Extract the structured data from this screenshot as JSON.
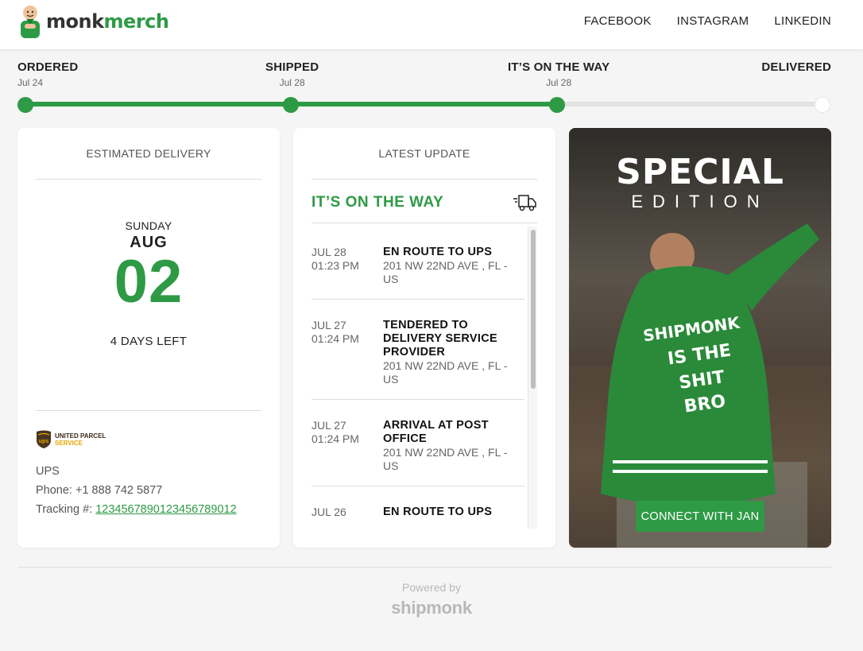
{
  "brand": {
    "part1": "monk",
    "part2": "merch",
    "accent": "#2e9a45"
  },
  "nav": [
    "FACEBOOK",
    "INSTAGRAM",
    "LINKEDIN"
  ],
  "progress": {
    "steps": [
      {
        "name": "ORDERED",
        "date": "Jul 24",
        "done": true
      },
      {
        "name": "SHIPPED",
        "date": "Jul 28",
        "done": true
      },
      {
        "name": "IT’S ON THE WAY",
        "date": "Jul 28",
        "done": true
      },
      {
        "name": "DELIVERED",
        "date": "",
        "done": false
      }
    ]
  },
  "estimated": {
    "title": "ESTIMATED DELIVERY",
    "weekday": "SUNDAY",
    "month": "AUG",
    "day": "02",
    "days_left": "4 DAYS LEFT",
    "carrier_logo_line1": "UNITED PARCEL",
    "carrier_logo_line2": "SERVICE",
    "carrier_logo_shield": "ups",
    "carrier": "UPS",
    "phone_label": "Phone:",
    "phone": "+1 888 742 5877",
    "tracking_label": "Tracking #:",
    "tracking": "12345678901234567890​12"
  },
  "latest": {
    "title": "LATEST UPDATE",
    "status": "IT’S ON THE WAY",
    "events": [
      {
        "date": "JUL 28",
        "time": "01:23 PM",
        "title": "EN ROUTE TO UPS",
        "location": "201 NW 22ND AVE , FL - US"
      },
      {
        "date": "JUL 27",
        "time": "01:24 PM",
        "title": "TENDERED TO DELIVERY SERVICE PROVIDER",
        "location": "201 NW 22ND AVE , FL - US"
      },
      {
        "date": "JUL 27",
        "time": "01:24 PM",
        "title": "ARRIVAL AT POST OFFICE",
        "location": "201 NW 22ND AVE , FL - US"
      },
      {
        "date": "JUL 26",
        "time": "",
        "title": "EN ROUTE TO UPS",
        "location": ""
      }
    ]
  },
  "promo": {
    "title": "SPECIAL",
    "subtitle": "EDITION",
    "jacket_text": [
      "SHIPMONK",
      "IS THE",
      "SHIT",
      "BRO"
    ],
    "button": "CONNECT WITH JAN"
  },
  "footer": {
    "powered": "Powered by",
    "brand": "shipmonk"
  }
}
